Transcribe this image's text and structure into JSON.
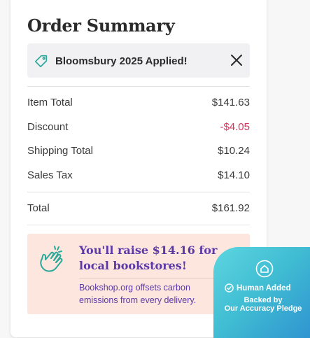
{
  "summary": {
    "title": "Order Summary",
    "promo_text": "Bloomsbury 2025 Applied!",
    "rows": [
      {
        "label": "Item Total",
        "value": "$141.63"
      },
      {
        "label": "Discount",
        "value": "-$4.05"
      },
      {
        "label": "Shipping Total",
        "value": "$10.24"
      },
      {
        "label": "Sales Tax",
        "value": "$14.10"
      }
    ],
    "total": {
      "label": "Total",
      "value": "$161.92"
    }
  },
  "callout": {
    "headline": "You'll raise $14.16 for local bookstores!",
    "body": "Bookshop.org offsets carbon emissions from every delivery."
  },
  "badge": {
    "human_added": "Human Added",
    "backed_line1": "Backed by",
    "backed_line2": "Our Accuracy Pledge"
  },
  "colors": {
    "discount": "#d2365e",
    "callout_text": "#5b3aa8",
    "callout_bg": "#fde6de",
    "icon_teal": "#2aa89a"
  },
  "icons": [
    "tag-icon",
    "close-icon",
    "clapping-hands-icon",
    "house-icon",
    "check-circle-icon"
  ]
}
